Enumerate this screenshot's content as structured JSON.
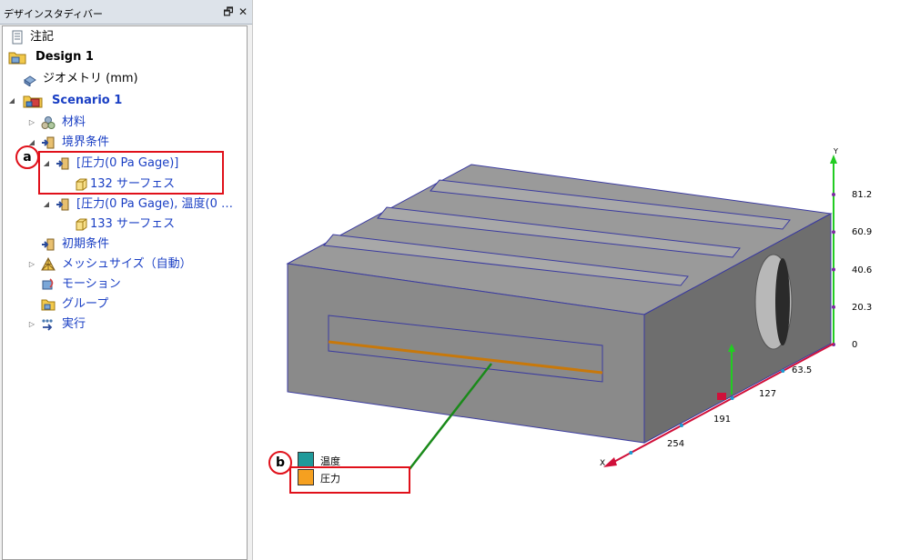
{
  "panel": {
    "title": "デザインスタディバー",
    "pin_glyph": "🗗",
    "close_glyph": "✕"
  },
  "tree": {
    "notes": "注記",
    "design": "Design 1",
    "geometry": "ジオメトリ (mm)",
    "scenario": "Scenario 1",
    "materials": "材料",
    "boundary_conditions": "境界条件",
    "bc1": "[圧力(0 Pa Gage)]",
    "bc1_surfaces": "132 サーフェス",
    "bc2": "[圧力(0 Pa Gage), 温度(0 …",
    "bc2_surfaces": "133 サーフェス",
    "initial_conditions": "初期条件",
    "mesh_size": "メッシュサイズ（自動）",
    "motion": "モーション",
    "groups": "グループ",
    "run": "実行"
  },
  "callouts": {
    "a": "a",
    "b": "b"
  },
  "legend": [
    {
      "label": "温度",
      "color": "#1f9a9a"
    },
    {
      "label": "圧力",
      "color": "#f5a020"
    }
  ],
  "axes": {
    "y_label": "Y",
    "x_label": "X",
    "y_ticks": [
      "81.2",
      "60.9",
      "40.6",
      "20.3",
      "0"
    ],
    "x_ticks": [
      "63.5",
      "127",
      "191",
      "254"
    ]
  },
  "colors": {
    "callout": "#e0101a",
    "tree_link": "#1a3fc4",
    "model_front": "#8a8a8a",
    "model_top": "#9a9a9a",
    "model_side": "#6e6e6e",
    "edge": "#3a3aa0",
    "pressure_line": "#c8780a",
    "leader": "#1a8a1a",
    "y_axis": "#22cc22",
    "x_axis": "#d0103a"
  }
}
